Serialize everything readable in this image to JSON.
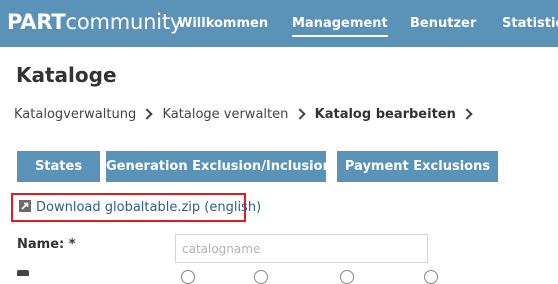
{
  "brand": {
    "bold": "PART",
    "light": "community"
  },
  "nav": {
    "items": [
      {
        "label": "Willkommen"
      },
      {
        "label": "Management",
        "active": true
      },
      {
        "label": "Benutzer"
      },
      {
        "label": "Statistic"
      }
    ]
  },
  "page": {
    "title": "Kataloge"
  },
  "breadcrumb": {
    "items": [
      "Katalogverwaltung",
      "Kataloge verwalten",
      "Katalog bearbeiten"
    ]
  },
  "buttons": {
    "states": "States",
    "generation": "Generation Exclusion/Inclusion",
    "payment": "Payment Exclusions"
  },
  "download": {
    "label": "Download globaltable.zip (english)"
  },
  "form": {
    "name_label": "Name: *",
    "name_placeholder": "catalogname",
    "name_value": ""
  },
  "colors": {
    "nav_bg": "#5b93b8",
    "button_bg": "#5b93b8",
    "highlight_border": "#e01b22",
    "link": "#2f5f86"
  }
}
